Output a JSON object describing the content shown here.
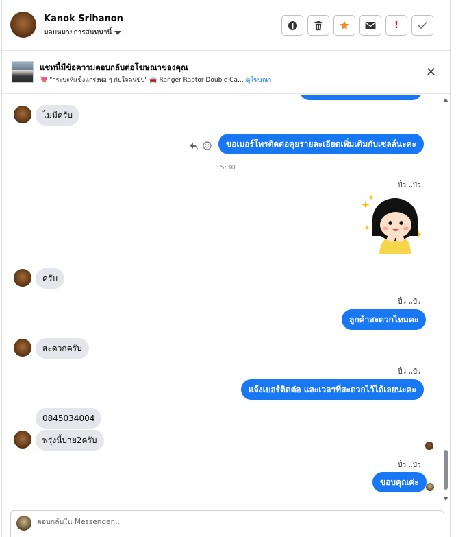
{
  "header": {
    "name": "Kanok Srihanon",
    "assign_label": "มอบหมายการสนทนานี้",
    "actions": {
      "alert": "!",
      "spam": "!"
    }
  },
  "ad": {
    "title": "แชทนี้มีข้อความตอบกลับต่อโฆษณาของคุณ",
    "description": "💘 \"กระบะที่แข็งแกร่งพอ ๆ กับใจคนขับ\" 🚘 Ranger Raptor Double Ca...",
    "link_label": "ดูโฆษณา",
    "close": "✕"
  },
  "messages": {
    "m1": "ไม่มีครับ",
    "m2": "ขอเบอร์โทรติดต่อคุยรายละเอียดเพิ่มเติมกับเซลล์นะคะ",
    "time1": "15:30",
    "sender1": "ปิ๋ว แป๋ว",
    "m3": "ครับ",
    "sender2": "ปิ๋ว แป๋ว",
    "m4": "ลูกค้าสะดวกไหมคะ",
    "m5": "สะดวกครับ",
    "sender3": "ปิ๋ว แป๋ว",
    "m6": "แจ้งเบอร์ติดต่อ  และเวลาที่สะดวกไว้ได้เลยนะคะ",
    "m7": "0845034004",
    "m8": "พรุ่งนี้บ่าย2ครับ",
    "sender4": "ปิ๋ว แป๋ว",
    "m9": "ขอบคุณค่ะ"
  },
  "composer": {
    "placeholder": "ตอบกลับใน Messenger..."
  },
  "colors": {
    "outgoing_bubble": "#1877f2",
    "incoming_bubble": "#e4e6eb",
    "star": "#f28a22",
    "spam": "#e02020"
  }
}
